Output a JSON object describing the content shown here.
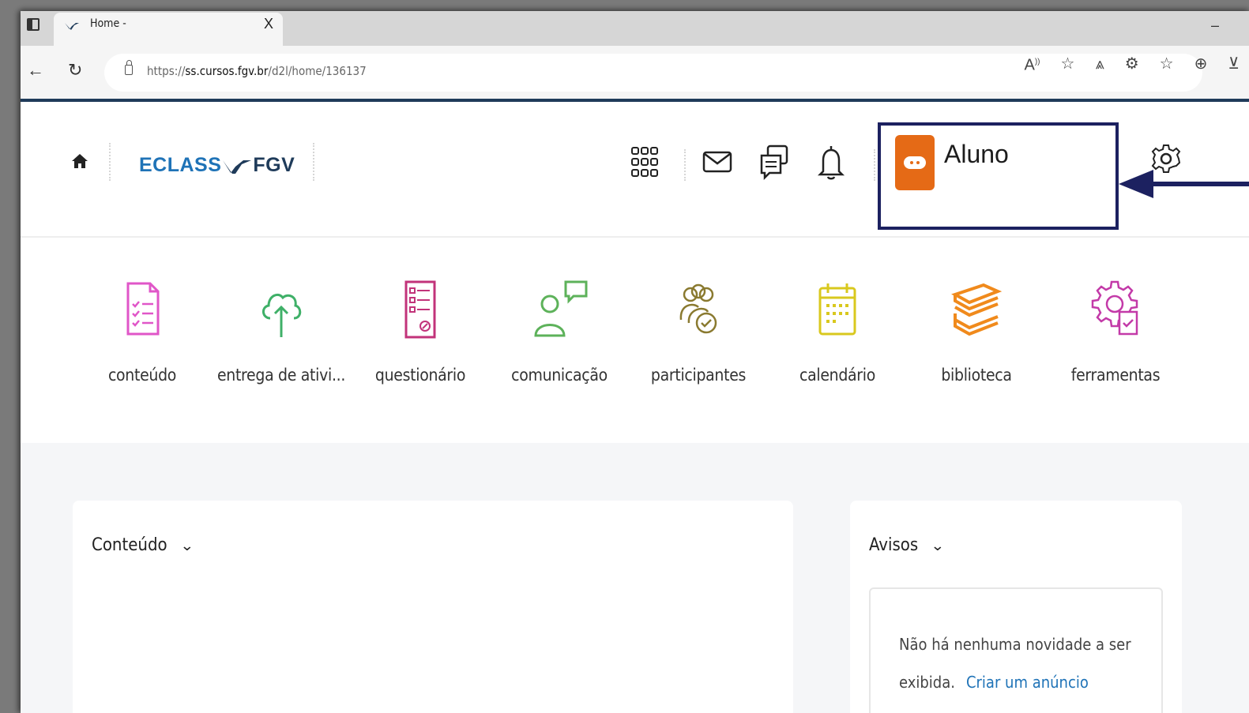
{
  "browser": {
    "tab_title": "Home -",
    "tab_close": "X",
    "url_prefix": "https://",
    "url_host": "ss.cursos.fgv.br",
    "url_path": "/d2l/home/136137",
    "minimize": "–"
  },
  "header": {
    "brand_left": "ECLASS",
    "brand_right": "FGV",
    "user_role": "Aluno",
    "colors": {
      "brand": "#1f73b7",
      "avatar": "#e56a16",
      "highlight_box": "#1c2160"
    }
  },
  "nav_tiles": [
    {
      "label": "conteúdo",
      "icon": "checklist-document-icon",
      "color": "#e056c8"
    },
    {
      "label": "entrega de ativi...",
      "icon": "cloud-upload-icon",
      "color": "#3fb068"
    },
    {
      "label": "questionário",
      "icon": "quiz-form-icon",
      "color": "#c2337a"
    },
    {
      "label": "comunicação",
      "icon": "person-chat-icon",
      "color": "#5db25a"
    },
    {
      "label": "participantes",
      "icon": "group-people-icon",
      "color": "#8a7a30"
    },
    {
      "label": "calendário",
      "icon": "calendar-icon",
      "color": "#d9c81e"
    },
    {
      "label": "biblioteca",
      "icon": "books-stack-icon",
      "color": "#f08a1c"
    },
    {
      "label": "ferramentas",
      "icon": "gear-tools-icon",
      "color": "#c33aa8"
    }
  ],
  "widgets": {
    "content_title": "Conteúdo",
    "notices_title": "Avisos",
    "notices_empty": "Não há nenhuma novidade a ser exibida.",
    "notices_link": "Criar um anúncio"
  }
}
